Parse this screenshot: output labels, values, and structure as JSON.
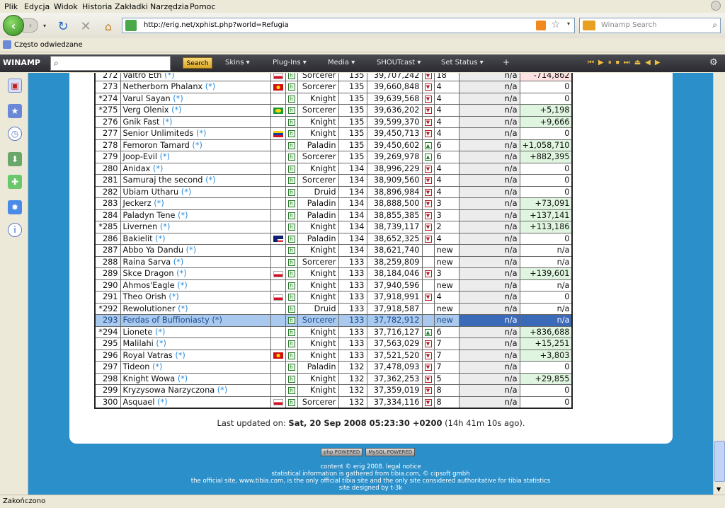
{
  "menu": [
    "Plik",
    "Edycja",
    "Widok",
    "Historia",
    "Zakładki",
    "Narzędzia",
    "Pomoc"
  ],
  "url": "http://erig.net/xphist.php?world=Refugia",
  "search_placeholder": "Winamp Search",
  "bookmark": "Często odwiedzane",
  "winamp": {
    "logo": "WINAMP",
    "search_btn": "Search",
    "items": [
      "Skins",
      "Plug-Ins",
      "Media",
      "SHOUTcast",
      "Set Status"
    ]
  },
  "rows": [
    [
      "272",
      "Valtro Eth",
      "flag-pl",
      "",
      "Sorcerer",
      "135",
      "39,707,242",
      "down",
      "18",
      "n/a",
      "-714,862",
      "neg"
    ],
    [
      "273",
      "Netherborn Phalanx",
      "flag-mk",
      "",
      "Sorcerer",
      "135",
      "39,660,848",
      "down",
      "4",
      "n/a",
      "0",
      ""
    ],
    [
      "274",
      "Varul Sayan",
      "",
      "*",
      "Knight",
      "135",
      "39,639,568",
      "down",
      "4",
      "n/a",
      "0",
      ""
    ],
    [
      "275",
      "Verg Olenix",
      "flag-br",
      "*",
      "Sorcerer",
      "135",
      "39,636,202",
      "down",
      "4",
      "n/a",
      "+5,198",
      "pos"
    ],
    [
      "276",
      "Gnik Fast",
      "",
      "",
      "Knight",
      "135",
      "39,599,370",
      "down",
      "4",
      "n/a",
      "+9,666",
      "pos"
    ],
    [
      "277",
      "Senior Unlimiteds",
      "flag-ve",
      "",
      "Knight",
      "135",
      "39,450,713",
      "down",
      "4",
      "n/a",
      "0",
      ""
    ],
    [
      "278",
      "Femoron Tamard",
      "",
      "",
      "Paladin",
      "135",
      "39,450,602",
      "up",
      "6",
      "n/a",
      "+1,058,710",
      "pos"
    ],
    [
      "279",
      "Joop-Evil",
      "",
      "",
      "Sorcerer",
      "135",
      "39,269,978",
      "up",
      "6",
      "n/a",
      "+882,395",
      "pos"
    ],
    [
      "280",
      "Anidax",
      "",
      "",
      "Knight",
      "134",
      "38,996,229",
      "down",
      "4",
      "n/a",
      "0",
      ""
    ],
    [
      "281",
      "Samuraj the second",
      "",
      "",
      "Sorcerer",
      "134",
      "38,909,560",
      "down",
      "4",
      "n/a",
      "0",
      ""
    ],
    [
      "282",
      "Ubiam Utharu",
      "",
      "",
      "Druid",
      "134",
      "38,896,984",
      "down",
      "4",
      "n/a",
      "0",
      ""
    ],
    [
      "283",
      "Jeckerz",
      "",
      "",
      "Paladin",
      "134",
      "38,888,500",
      "down",
      "3",
      "n/a",
      "+73,091",
      "pos"
    ],
    [
      "284",
      "Paladyn Tene",
      "",
      "",
      "Paladin",
      "134",
      "38,855,385",
      "down",
      "3",
      "n/a",
      "+137,141",
      "pos"
    ],
    [
      "285",
      "Livernen",
      "",
      "*",
      "Knight",
      "134",
      "38,739,117",
      "down",
      "2",
      "n/a",
      "+113,186",
      "pos"
    ],
    [
      "286",
      "Bakielit",
      "flag-my",
      "",
      "Paladin",
      "134",
      "38,652,325",
      "down",
      "4",
      "n/a",
      "0",
      ""
    ],
    [
      "287",
      "Abbo Ya Dandu",
      "",
      "",
      "Knight",
      "134",
      "38,621,740",
      "",
      "new",
      "n/a",
      "n/a",
      ""
    ],
    [
      "288",
      "Raina Sarva",
      "",
      "",
      "Sorcerer",
      "133",
      "38,259,809",
      "",
      "new",
      "n/a",
      "n/a",
      ""
    ],
    [
      "289",
      "Skce Dragon",
      "flag-pl",
      "",
      "Knight",
      "133",
      "38,184,046",
      "down",
      "3",
      "n/a",
      "+139,601",
      "pos"
    ],
    [
      "290",
      "Ahmos'Eagle",
      "",
      "",
      "Knight",
      "133",
      "37,940,596",
      "",
      "new",
      "n/a",
      "n/a",
      ""
    ],
    [
      "291",
      "Theo Orish",
      "flag-pl",
      "",
      "Knight",
      "133",
      "37,918,991",
      "down",
      "4",
      "n/a",
      "0",
      ""
    ],
    [
      "292",
      "Rewolutioner",
      "",
      "*",
      "Druid",
      "133",
      "37,918,587",
      "",
      "new",
      "n/a",
      "n/a",
      ""
    ],
    [
      "293",
      "Ferdas of Buffioniasty",
      "",
      "",
      "Sorcerer",
      "133",
      "37,782,912",
      "",
      "new",
      "n/a",
      "n/a",
      "sel"
    ],
    [
      "294",
      "Lionete",
      "",
      "*",
      "Knight",
      "133",
      "37,716,127",
      "up",
      "6",
      "n/a",
      "+836,688",
      "pos"
    ],
    [
      "295",
      "Malilahi",
      "",
      "",
      "Knight",
      "133",
      "37,563,029",
      "down",
      "7",
      "n/a",
      "+15,251",
      "pos"
    ],
    [
      "296",
      "Royal Vatras",
      "flag-mk",
      "",
      "Knight",
      "133",
      "37,521,520",
      "down",
      "7",
      "n/a",
      "+3,803",
      "pos"
    ],
    [
      "297",
      "Tideon",
      "",
      "",
      "Paladin",
      "132",
      "37,478,093",
      "down",
      "7",
      "n/a",
      "0",
      ""
    ],
    [
      "298",
      "Knight Wowa",
      "",
      "",
      "Knight",
      "132",
      "37,362,253",
      "down",
      "5",
      "n/a",
      "+29,855",
      "pos"
    ],
    [
      "299",
      "Kryzysowa Narzyczona",
      "",
      "",
      "Knight",
      "132",
      "37,359,019",
      "down",
      "8",
      "n/a",
      "0",
      ""
    ],
    [
      "300",
      "Asquael",
      "flag-pl",
      "",
      "Sorcerer",
      "132",
      "37,334,116",
      "down",
      "8",
      "n/a",
      "0",
      ""
    ]
  ],
  "updated_label": "Last updated on:",
  "updated_value": "Sat, 20 Sep 2008 05:23:30 +0200",
  "updated_ago": "(14h 41m 10s ago).",
  "footer": {
    "badge1": "php POWERED",
    "badge2": "MySQL POWERED",
    "line1": "content © erig 2008. legal notice",
    "line2": "statistical information is gathered from tibia.com, © cipsoft gmbh",
    "line3": "the official site, www.tibia.com, is the only official tibia site and the only site considered authoritative for tibia statistics",
    "line4": "site designed by t-3k"
  },
  "status": "Zakończono"
}
